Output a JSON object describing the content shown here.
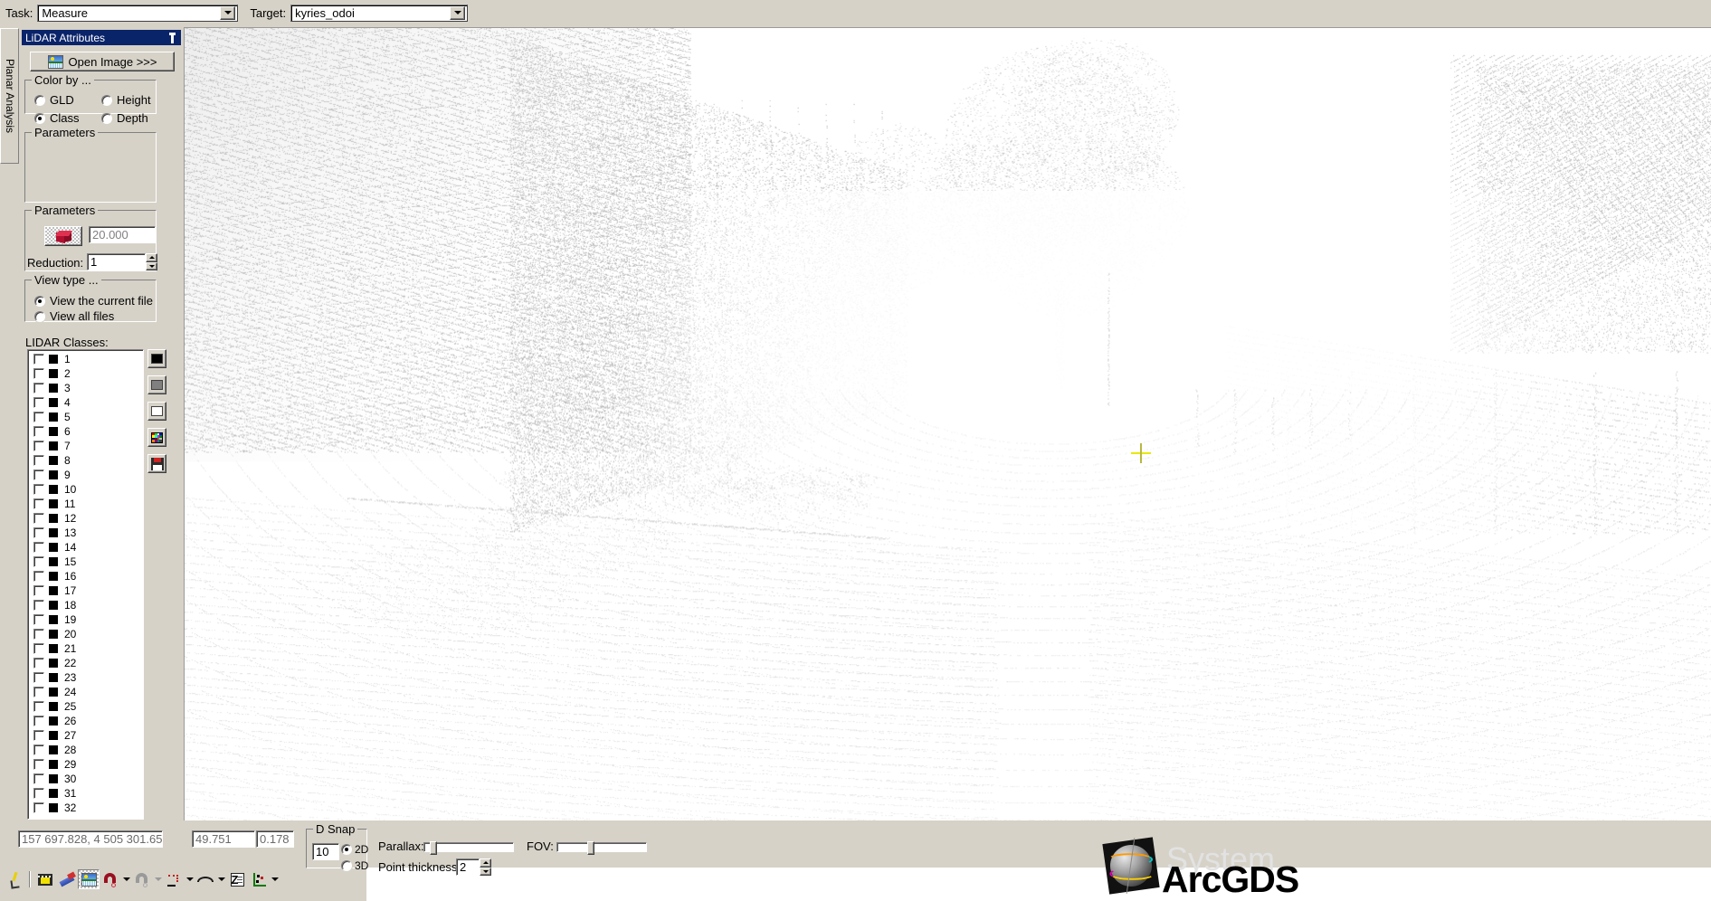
{
  "topbar": {
    "task_label": "Task:",
    "task_value": "Measure",
    "target_label": "Target:",
    "target_value": "kyries_odoi"
  },
  "vertical_tab": {
    "label": "Planar Analysis"
  },
  "dock": {
    "title": "LiDAR Attributes",
    "pin_icon": "pin-icon",
    "open_image_button": "Open Image >>>",
    "open_image_icon": "image-icon",
    "color_by": {
      "legend": "Color by ...",
      "options": [
        {
          "label": "GLD",
          "selected": false
        },
        {
          "label": "Height",
          "selected": false
        },
        {
          "label": "Class",
          "selected": true
        },
        {
          "label": "Depth",
          "selected": false
        }
      ]
    },
    "parameters_1": {
      "legend": "Parameters"
    },
    "parameters_2": {
      "legend": "Parameters",
      "cube_icon": "red-cube-icon",
      "value_field": "20.000",
      "reduction_label": "Reduction:",
      "reduction_value": "1"
    },
    "view_type": {
      "legend": "View type ...",
      "options": [
        {
          "label": "View the current file",
          "selected": true
        },
        {
          "label": "View all files",
          "selected": false
        }
      ]
    },
    "classes": {
      "label": "LIDAR Classes:",
      "items": [
        {
          "id": "1",
          "color": "#000000",
          "checked": false
        },
        {
          "id": "2",
          "color": "#000000",
          "checked": false
        },
        {
          "id": "3",
          "color": "#000000",
          "checked": false
        },
        {
          "id": "4",
          "color": "#000000",
          "checked": false
        },
        {
          "id": "5",
          "color": "#000000",
          "checked": false
        },
        {
          "id": "6",
          "color": "#000000",
          "checked": false
        },
        {
          "id": "7",
          "color": "#000000",
          "checked": false
        },
        {
          "id": "8",
          "color": "#000000",
          "checked": false
        },
        {
          "id": "9",
          "color": "#000000",
          "checked": false
        },
        {
          "id": "10",
          "color": "#000000",
          "checked": false
        },
        {
          "id": "11",
          "color": "#000000",
          "checked": false
        },
        {
          "id": "12",
          "color": "#000000",
          "checked": false
        },
        {
          "id": "13",
          "color": "#000000",
          "checked": false
        },
        {
          "id": "14",
          "color": "#000000",
          "checked": false
        },
        {
          "id": "15",
          "color": "#000000",
          "checked": false
        },
        {
          "id": "16",
          "color": "#000000",
          "checked": false
        },
        {
          "id": "17",
          "color": "#000000",
          "checked": false
        },
        {
          "id": "18",
          "color": "#000000",
          "checked": false
        },
        {
          "id": "19",
          "color": "#000000",
          "checked": false
        },
        {
          "id": "20",
          "color": "#000000",
          "checked": false
        },
        {
          "id": "21",
          "color": "#000000",
          "checked": false
        },
        {
          "id": "22",
          "color": "#000000",
          "checked": false
        },
        {
          "id": "23",
          "color": "#000000",
          "checked": false
        },
        {
          "id": "24",
          "color": "#000000",
          "checked": false
        },
        {
          "id": "25",
          "color": "#000000",
          "checked": false
        },
        {
          "id": "26",
          "color": "#000000",
          "checked": false
        },
        {
          "id": "27",
          "color": "#000000",
          "checked": false
        },
        {
          "id": "28",
          "color": "#000000",
          "checked": false
        },
        {
          "id": "29",
          "color": "#000000",
          "checked": false
        },
        {
          "id": "30",
          "color": "#000000",
          "checked": false
        },
        {
          "id": "31",
          "color": "#000000",
          "checked": false
        },
        {
          "id": "32",
          "color": "#000000",
          "checked": false
        }
      ],
      "side_buttons": [
        {
          "name": "set-color-black",
          "icon": "black-swatch-icon",
          "color": "#000000"
        },
        {
          "name": "set-color-gray",
          "icon": "gray-swatch-icon",
          "color": "#808080"
        },
        {
          "name": "set-color-white",
          "icon": "white-swatch-icon",
          "color": "#ffffff"
        },
        {
          "name": "open-palette",
          "icon": "color-palette-icon",
          "color": ""
        },
        {
          "name": "save-classes",
          "icon": "floppy-disk-icon",
          "color": ""
        }
      ]
    }
  },
  "viewport": {
    "name": "lidar-point-cloud-view",
    "cursor_icon": "crosshair-cursor",
    "cursor_color": "#e8e800",
    "background": "#ffffff"
  },
  "statusbar": {
    "coordinates": "157 697.828, 4 505 301.651",
    "value_1": "49.751",
    "value_2": "0.178",
    "d_snap": {
      "legend": "D Snap",
      "value": "10",
      "modes": [
        {
          "label": "2D",
          "selected": true
        },
        {
          "label": "3D",
          "selected": false
        }
      ]
    },
    "parallax_label": "Parallax:",
    "parallax_pct": 6,
    "fov_label": "FOV:",
    "fov_pct": 36,
    "point_thickness_label": "Point thickness:",
    "point_thickness_value": "2"
  },
  "toolbar": {
    "tools": [
      {
        "name": "pick-pen-tool",
        "icon": "pen-tool-icon",
        "selected": false,
        "menu": false
      },
      {
        "name": "film-tool",
        "icon": "film-strip-icon",
        "selected": false,
        "menu": false
      },
      {
        "name": "eraser-tool",
        "icon": "eraser-icon",
        "selected": false,
        "menu": false
      },
      {
        "name": "image-tool",
        "icon": "image-icon",
        "selected": true,
        "menu": false
      },
      {
        "name": "snap-magnet-tool",
        "icon": "magnet-icon",
        "selected": false,
        "menu": true,
        "enabled": true
      },
      {
        "name": "snap-magnet-m-tool",
        "icon": "magnet-m-icon",
        "selected": false,
        "menu": true,
        "enabled": false
      },
      {
        "name": "point-snap-tool",
        "icon": "point-snap-icon",
        "selected": false,
        "menu": true,
        "enabled": true
      },
      {
        "name": "curve-tool",
        "icon": "wave-curve-icon",
        "selected": false,
        "menu": true,
        "enabled": true
      },
      {
        "name": "note-tool",
        "icon": "z-note-icon",
        "selected": false,
        "menu": false
      },
      {
        "name": "axis-tool",
        "icon": "axis-points-icon",
        "selected": false,
        "menu": true,
        "enabled": true
      }
    ]
  },
  "logo": {
    "watermark": "System",
    "brand": "ArcGDS",
    "globe_icon": "globe-logo-icon"
  }
}
